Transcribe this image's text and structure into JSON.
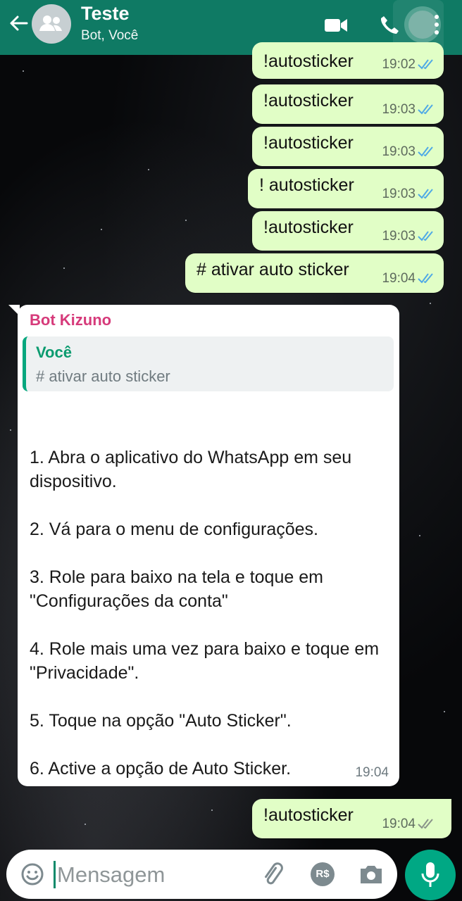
{
  "header": {
    "title": "Teste",
    "subtitle": "Bot, Você",
    "icons": [
      "back-arrow-icon",
      "group-avatar-icon",
      "video-call-icon",
      "phone-icon",
      "more-options-icon"
    ]
  },
  "outgoing_messages": [
    {
      "text": "!autosticker",
      "time": "19:02",
      "status": "read"
    },
    {
      "text": "!autosticker",
      "time": "19:03",
      "status": "read"
    },
    {
      "text": "!autosticker",
      "time": "19:03",
      "status": "read"
    },
    {
      "text": "! autosticker",
      "time": "19:03",
      "status": "read"
    },
    {
      "text": "!autosticker",
      "time": "19:03",
      "status": "read"
    },
    {
      "text": "# ativar auto sticker",
      "time": "19:04",
      "status": "read"
    }
  ],
  "incoming_message": {
    "sender": "Bot Kizuno",
    "quote_author": "Você",
    "quote_text": "# ativar auto sticker",
    "body": "1. Abra o aplicativo do WhatsApp em seu dispositivo.\n\n2. Vá para o menu de configurações.\n\n3. Role para baixo na tela e toque em \"Configurações da conta\"\n\n4. Role mais uma vez para baixo e toque em \"Privacidade\".\n\n5. Toque na opção \"Auto Sticker\".\n\n6. Active a opção de Auto Sticker.",
    "time": "19:04"
  },
  "last_message": {
    "text": "!autosticker",
    "time": "19:04",
    "status": "delivered"
  },
  "input": {
    "placeholder": "Mensagem",
    "value": "",
    "icons": [
      "emoji-icon",
      "attach-icon",
      "payment-icon",
      "camera-icon",
      "mic-icon"
    ],
    "payment_label": "R$"
  },
  "colors": {
    "header": "#0f7a64",
    "outgoing_bubble": "#e1fec6",
    "read_check": "#4fa9e6",
    "sender": "#d63a7a",
    "mic_button": "#00a884"
  }
}
